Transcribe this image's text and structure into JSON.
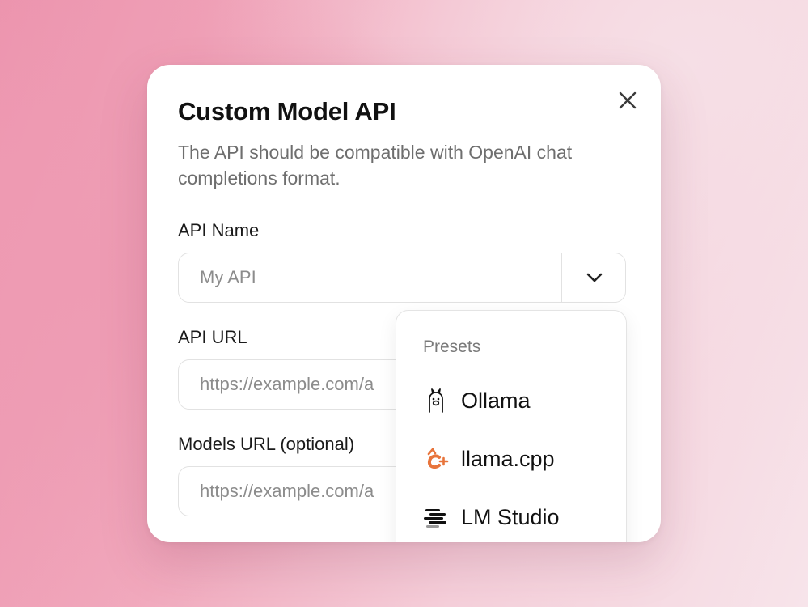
{
  "dialog": {
    "title": "Custom Model API",
    "description": "The API should be compatible with OpenAI chat completions format.",
    "close_icon": "close-icon"
  },
  "fields": {
    "api_name": {
      "label": "API Name",
      "placeholder": "My API"
    },
    "api_url": {
      "label": "API URL",
      "placeholder": "https://example.com/a"
    },
    "models_url": {
      "label": "Models URL (optional)",
      "placeholder": "https://example.com/a"
    }
  },
  "presets": {
    "heading": "Presets",
    "items": [
      {
        "label": "Ollama",
        "icon": "ollama-llama-icon"
      },
      {
        "label": "llama.cpp",
        "icon": "llamacpp-icon",
        "color": "#e8743b"
      },
      {
        "label": "LM Studio",
        "icon": "lmstudio-icon"
      }
    ]
  },
  "colors": {
    "accent_orange": "#e8743b",
    "text_primary": "#111111",
    "text_secondary": "#6e6e6e"
  }
}
